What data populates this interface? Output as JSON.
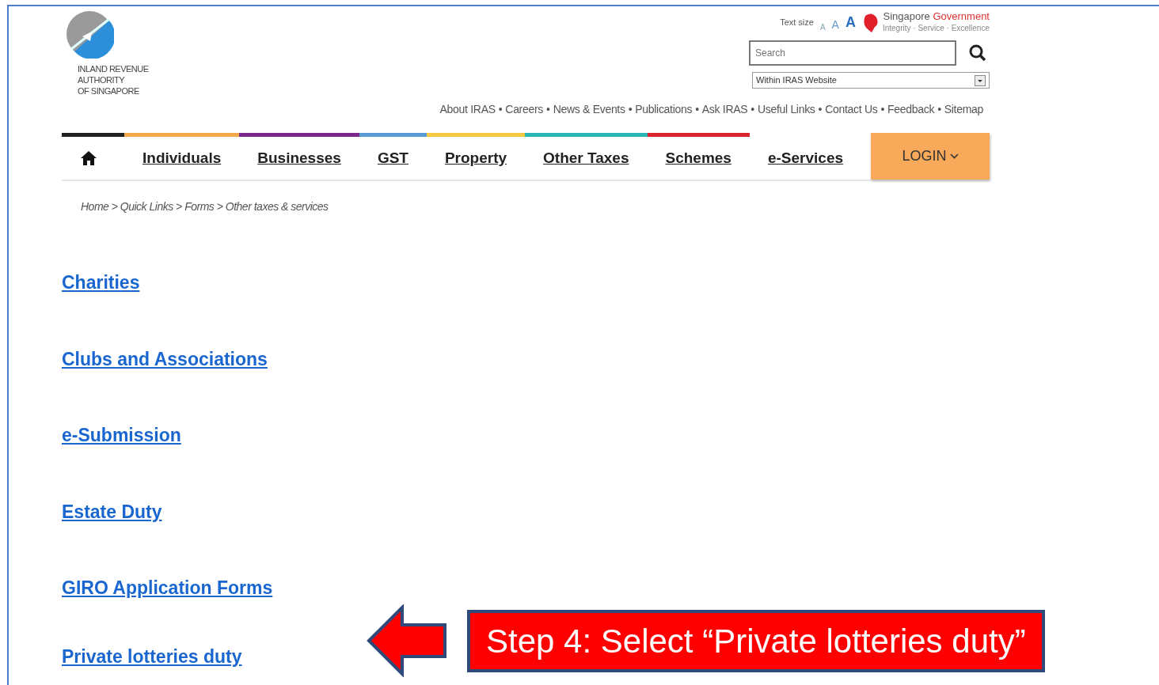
{
  "logo": {
    "lines": [
      "INLAND REVENUE",
      "AUTHORITY",
      "OF SINGAPORE"
    ]
  },
  "text_size": {
    "label": "Text size",
    "options": [
      "A",
      "A",
      "A"
    ]
  },
  "gov_brand": {
    "name_part1": "Singapore",
    "name_part2": "Government",
    "motto": "Integrity · Service · Excellence"
  },
  "search": {
    "placeholder": "Search",
    "scope": "Within IRAS Website"
  },
  "top_links": {
    "separator": "•",
    "items": [
      "About IRAS",
      "Careers",
      "News & Events",
      "Publications",
      "Ask IRAS",
      "Useful Links",
      "Contact Us",
      "Feedback",
      "Sitemap"
    ]
  },
  "nav": [
    {
      "kind": "home",
      "color": "#222222"
    },
    {
      "kind": "link",
      "label": "Individuals",
      "color": "#f5a94a"
    },
    {
      "kind": "link",
      "label": "Businesses",
      "color": "#7b2a8c"
    },
    {
      "kind": "link",
      "label": "GST",
      "color": "#5b9bd5"
    },
    {
      "kind": "link",
      "label": "Property",
      "color": "#f5c842"
    },
    {
      "kind": "link",
      "label": "Other Taxes",
      "color": "#2bb5b5"
    },
    {
      "kind": "link",
      "label": "Schemes",
      "color": "#d9232e"
    },
    {
      "kind": "link",
      "label": "e-Services"
    },
    {
      "kind": "login",
      "label": "LOGIN"
    }
  ],
  "breadcrumb": {
    "separator": ">",
    "links": [
      "Home",
      "Quick Links",
      "Forms"
    ],
    "current": "Other taxes & services"
  },
  "form_links": [
    "Charities",
    "Clubs and Associations",
    "e-Submission",
    "Estate Duty",
    "GIRO Application Forms",
    "Private lotteries duty"
  ],
  "callout": {
    "text": "Step 4: Select “Private lotteries duty”"
  }
}
